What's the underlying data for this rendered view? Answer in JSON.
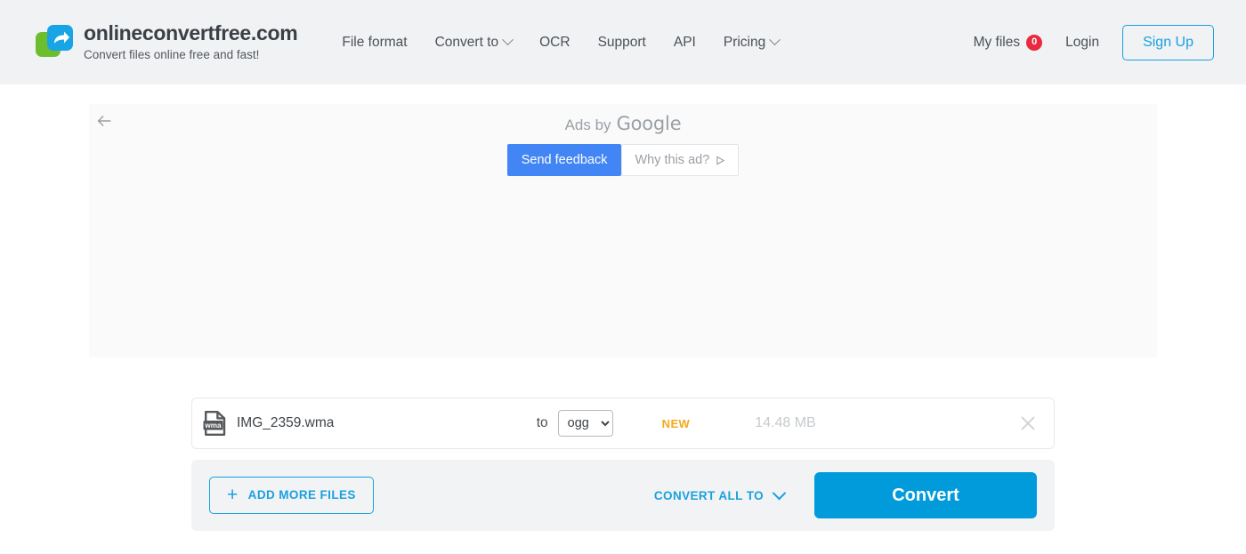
{
  "header": {
    "logo_icon": "convert-arrow-logo",
    "brand_title": "onlineconvertfree.com",
    "brand_tagline": "Convert files online free and fast!",
    "nav": [
      {
        "label": "File format",
        "has_caret": false
      },
      {
        "label": "Convert to",
        "has_caret": true
      },
      {
        "label": "OCR",
        "has_caret": false
      },
      {
        "label": "Support",
        "has_caret": false
      },
      {
        "label": "API",
        "has_caret": false
      },
      {
        "label": "Pricing",
        "has_caret": true
      }
    ],
    "my_files_label": "My files",
    "my_files_count": "0",
    "login_label": "Login",
    "signup_label": "Sign Up"
  },
  "ad": {
    "back_icon": "arrow-left-icon",
    "ads_by_text": "Ads by",
    "google_text": "Google",
    "send_feedback_label": "Send feedback",
    "why_this_ad_label": "Why this ad?",
    "why_this_ad_icon": "play-triangle-icon"
  },
  "file_row": {
    "file_type_icon": "wma",
    "file_name": "IMG_2359.wma",
    "to_label": "to",
    "target_format": "ogg",
    "format_options": [
      "ogg"
    ],
    "new_badge": "NEW",
    "file_size": "14.48 MB",
    "remove_icon": "close-icon"
  },
  "actions": {
    "add_more_label": "ADD MORE FILES",
    "add_more_icon": "plus-icon",
    "convert_all_label": "CONVERT ALL TO",
    "convert_all_icon": "chevron-down-icon",
    "convert_label": "Convert"
  },
  "colors": {
    "brand_blue": "#019bdc",
    "accent_orange": "#f7a81b",
    "badge_red": "#e8293f",
    "logo_green": "#6cbe2c",
    "logo_blue": "#19a4e5",
    "header_bg": "#f0f2f4",
    "ad_bg": "#fafafa",
    "action_bar_bg": "#f1f3f5",
    "google_blue": "#4285f4"
  }
}
